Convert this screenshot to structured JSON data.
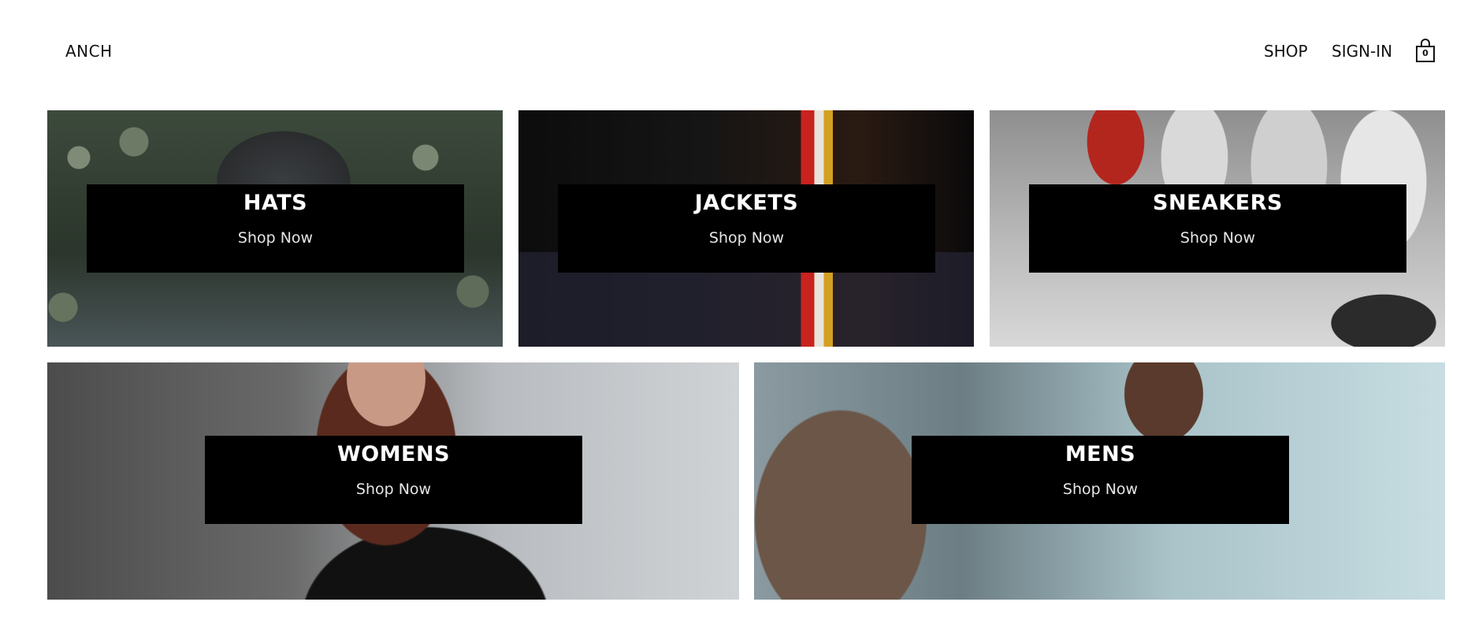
{
  "header": {
    "logo": "ANCH",
    "nav": {
      "shop": "SHOP",
      "sign_in": "SIGN-IN"
    },
    "cart": {
      "icon": "shopping-bag-icon",
      "count": "0"
    }
  },
  "categories": [
    {
      "title": "HATS",
      "cta": "Shop Now"
    },
    {
      "title": "JACKETS",
      "cta": "Shop Now"
    },
    {
      "title": "SNEAKERS",
      "cta": "Shop Now"
    },
    {
      "title": "WOMENS",
      "cta": "Shop Now"
    },
    {
      "title": "MENS",
      "cta": "Shop Now"
    }
  ],
  "colors": {
    "overlay_background": "#000000",
    "overlay_text": "#ffffff",
    "page_background": "#ffffff"
  }
}
